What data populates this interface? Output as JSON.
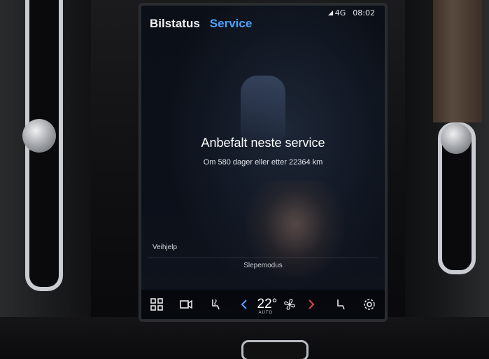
{
  "status_bar": {
    "network": "4G",
    "time": "08:02"
  },
  "tabs": [
    {
      "label": "Bilstatus",
      "active": false
    },
    {
      "label": "Service",
      "active": true
    }
  ],
  "service": {
    "headline": "Anbefalt neste service",
    "detail": "Om 580 dager eller etter 22364 km"
  },
  "options": {
    "roadside": "Veihjelp",
    "tow_mode": "Slepemodus"
  },
  "climate": {
    "temperature": "22°",
    "mode": "AUTO"
  },
  "colors": {
    "accent": "#4aa3ff",
    "arrow_left": "#4aa3ff",
    "arrow_right": "#e04545"
  }
}
